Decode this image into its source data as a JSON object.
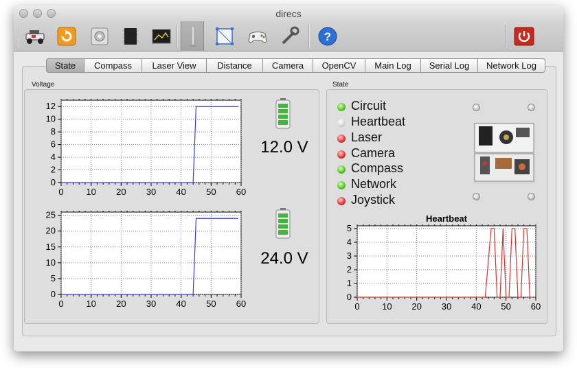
{
  "window": {
    "title": "direcs"
  },
  "toolbar": {
    "buttons": [
      {
        "name": "robot-icon",
        "active": false
      },
      {
        "name": "refresh-icon",
        "active": false
      },
      {
        "name": "settings-icon",
        "active": false
      },
      {
        "name": "chip-icon",
        "active": false
      },
      {
        "name": "image-icon",
        "active": false
      },
      {
        "name": "laser-pointer-icon",
        "active": true
      },
      {
        "name": "camera-frame-icon",
        "active": false
      },
      {
        "name": "gamepad-icon",
        "active": false
      },
      {
        "name": "wrench-icon",
        "active": false
      },
      {
        "name": "help-icon",
        "active": false
      },
      {
        "name": "power-icon",
        "active": false
      }
    ]
  },
  "tabs": [
    "State",
    "Compass",
    "Laser View",
    "Distance",
    "Camera",
    "OpenCV",
    "Main Log",
    "Serial Log",
    "Network Log"
  ],
  "selected_tab": "State",
  "voltage": {
    "label": "Voltage",
    "readings": [
      {
        "text": "12.0 V",
        "level": 1.0
      },
      {
        "text": "24.0 V",
        "level": 1.0
      }
    ]
  },
  "state": {
    "label": "State",
    "items": [
      {
        "label": "Circuit",
        "status": "green"
      },
      {
        "label": "Heartbeat",
        "status": "gray"
      },
      {
        "label": "Laser",
        "status": "red"
      },
      {
        "label": "Camera",
        "status": "red"
      },
      {
        "label": "Compass",
        "status": "green"
      },
      {
        "label": "Network",
        "status": "green"
      },
      {
        "label": "Joystick",
        "status": "red"
      }
    ]
  },
  "chart_data": [
    {
      "type": "line",
      "title": "",
      "xlabel": "",
      "ylabel": "",
      "xlim": [
        0,
        60
      ],
      "ylim": [
        0,
        13
      ],
      "xticks": [
        0,
        10,
        20,
        30,
        40,
        50,
        60
      ],
      "yticks": [
        0,
        2,
        4,
        6,
        8,
        10,
        12
      ],
      "grid": true,
      "color": "#3b3bd6",
      "series": [
        {
          "x": [
            0,
            44,
            45,
            59
          ],
          "y": [
            0,
            0,
            12,
            12
          ]
        }
      ]
    },
    {
      "type": "line",
      "title": "",
      "xlabel": "",
      "ylabel": "",
      "xlim": [
        0,
        60
      ],
      "ylim": [
        0,
        26
      ],
      "xticks": [
        0,
        10,
        20,
        30,
        40,
        50,
        60
      ],
      "yticks": [
        0,
        5,
        10,
        15,
        20,
        25
      ],
      "grid": true,
      "color": "#3b3bd6",
      "series": [
        {
          "x": [
            0,
            44,
            45,
            59
          ],
          "y": [
            0,
            0,
            24,
            24
          ]
        }
      ]
    },
    {
      "type": "line",
      "title": "Heartbeat",
      "xlabel": "",
      "ylabel": "",
      "xlim": [
        0,
        60
      ],
      "ylim": [
        0,
        5.2
      ],
      "xticks": [
        0,
        10,
        20,
        30,
        40,
        50,
        60
      ],
      "yticks": [
        0,
        1,
        2,
        3,
        4,
        5
      ],
      "grid": true,
      "color": "#d63030",
      "series": [
        {
          "x": [
            0,
            43,
            45,
            46,
            47,
            48,
            49,
            50,
            51,
            52,
            53,
            54,
            55,
            56,
            57,
            58,
            59
          ],
          "y": [
            0,
            0,
            5,
            5,
            0,
            0,
            5,
            0,
            0,
            5,
            5,
            0,
            0,
            5,
            5,
            0,
            0
          ]
        }
      ]
    }
  ]
}
